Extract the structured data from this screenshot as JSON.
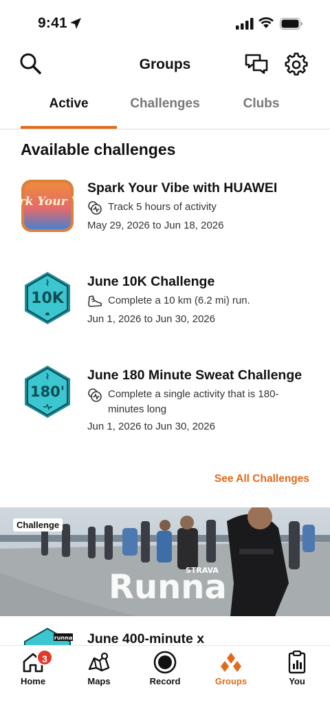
{
  "status_bar": {
    "time": "9:41"
  },
  "header": {
    "title": "Groups"
  },
  "tabs": [
    {
      "label": "Active"
    },
    {
      "label": "Challenges"
    },
    {
      "label": "Clubs"
    }
  ],
  "section": {
    "title": "Available challenges"
  },
  "challenges": [
    {
      "badge_text": "Spark Your Vibe",
      "title": "Spark Your Vibe with HUAWEI",
      "description": "Track 5 hours of activity",
      "dates": "May 29, 2026 to Jun 18, 2026",
      "desc_icon": "activity-icon"
    },
    {
      "badge_text": "10K",
      "title": "June 10K Challenge",
      "description": "Complete a 10 km (6.2 mi) run.",
      "dates": "Jun 1, 2026 to Jun 30, 2026",
      "desc_icon": "shoe-icon"
    },
    {
      "badge_text": "180'",
      "title": "June 180 Minute Sweat Challenge",
      "description": "Complete a single activity that is 180-minutes long",
      "dates": "Jun 1, 2026 to Jun 30, 2026",
      "desc_icon": "activity-icon"
    }
  ],
  "see_all": "See All Challenges",
  "banner": {
    "tag": "Challenge",
    "brand": "Runna",
    "sub_brand": "STRAVA"
  },
  "partial_challenge": {
    "title": "June 400-minute x",
    "badge_text": "runna"
  },
  "bottom_nav": {
    "items": [
      {
        "label": "Home",
        "badge": "3"
      },
      {
        "label": "Maps"
      },
      {
        "label": "Record"
      },
      {
        "label": "Groups"
      },
      {
        "label": "You"
      }
    ]
  },
  "colors": {
    "accent": "#e36a1b",
    "badge_teal": "#2bb8c4",
    "notification": "#e23a2a"
  }
}
